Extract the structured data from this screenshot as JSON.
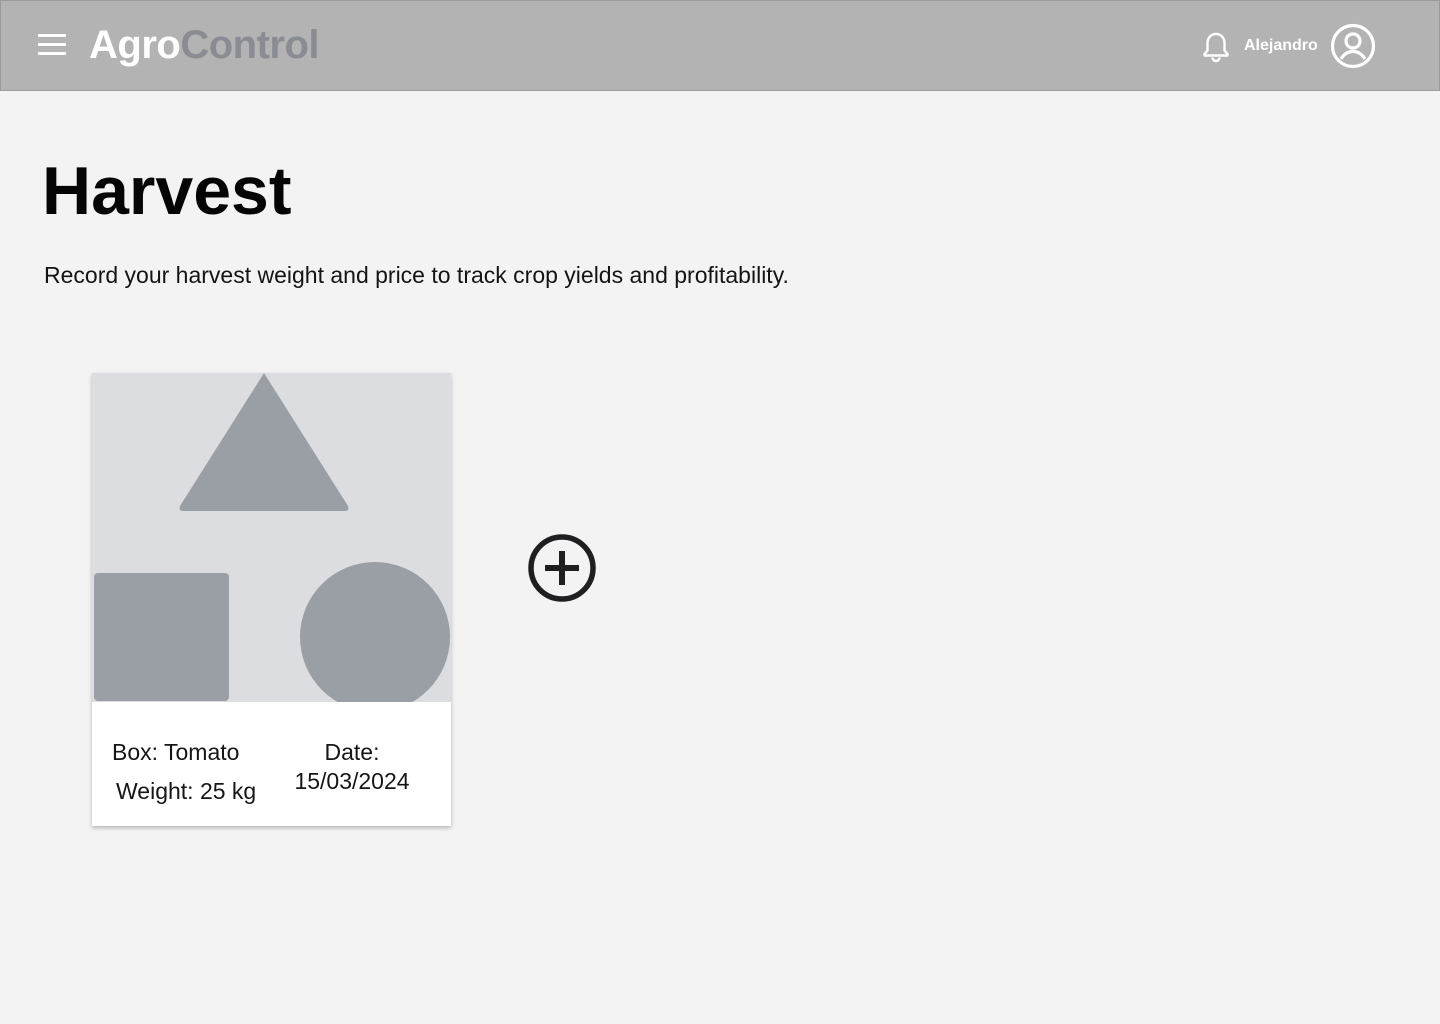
{
  "header": {
    "brand_part1": "Agro",
    "brand_part2": "Control",
    "username": "Alejandro"
  },
  "page": {
    "title": "Harvest",
    "description": "Record your harvest weight and price to track crop yields and profitability."
  },
  "harvest_cards": [
    {
      "box": "Box: Tomato",
      "weight": "Weight: 25 kg",
      "date": "Date: 15/03/2024"
    }
  ],
  "icons": {
    "menu": "menu-icon",
    "bell": "bell-icon",
    "avatar": "user-avatar-icon",
    "add": "add-circle-icon",
    "image_placeholder": "image-placeholder-icon"
  },
  "colors": {
    "header_bg": "#b3b3b3",
    "brand_secondary": "#8a8c94",
    "placeholder_bg": "#dcdde0",
    "placeholder_shapes": "#9a9ea5"
  }
}
